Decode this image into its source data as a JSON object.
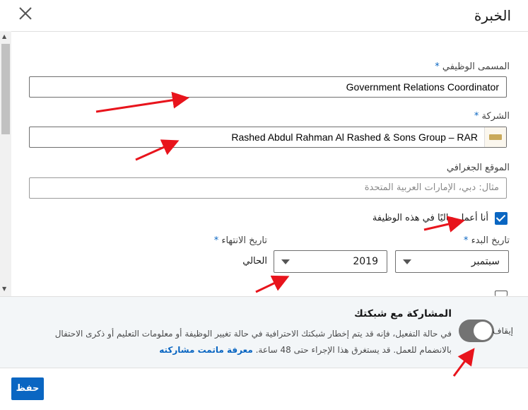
{
  "dialog": {
    "title": "الخبرة"
  },
  "form": {
    "title_field": {
      "label": "المسمى الوظيفي",
      "required_mark": "*",
      "value": "Government Relations Coordinator"
    },
    "company_field": {
      "label": "الشركة",
      "required_mark": "*",
      "value": "Rashed Abdul Rahman Al Rashed & Sons Group – RAR"
    },
    "location_field": {
      "label": "الموقع الجغرافي",
      "placeholder": "مثال: دبي، الإمارات العربية المتحدة"
    },
    "current_role_checkbox": {
      "label": "أنا أعمل حاليًا في هذه الوظيفة",
      "checked": true
    },
    "start_date": {
      "label": "تاريخ البدء",
      "required_mark": "*",
      "month": "سبتمبر",
      "year": "2019"
    },
    "end_date": {
      "label": "تاريخ الانتهاء",
      "required_mark": "*",
      "present_text": "الحالي"
    }
  },
  "share": {
    "title": "المشاركة مع شبكتك",
    "description": "في حالة التفعيل، فإنه قد يتم إخطار شبكتك الاحترافية في حالة تغيير الوظيفة أو معلومات التعليم أو ذكرى الاحتفال بالانضمام للعمل. قد يستغرق هذا الإجراء حتى 48 ساعة.",
    "link_text": "معرفة ماتمت مشاركته",
    "toggle_label": "إيقاف",
    "toggle_on": false
  },
  "footer": {
    "save_label": "حفظ"
  },
  "colors": {
    "accent": "#0a66c2",
    "annotation": "#e8141c",
    "toggle_off": "#737373"
  }
}
